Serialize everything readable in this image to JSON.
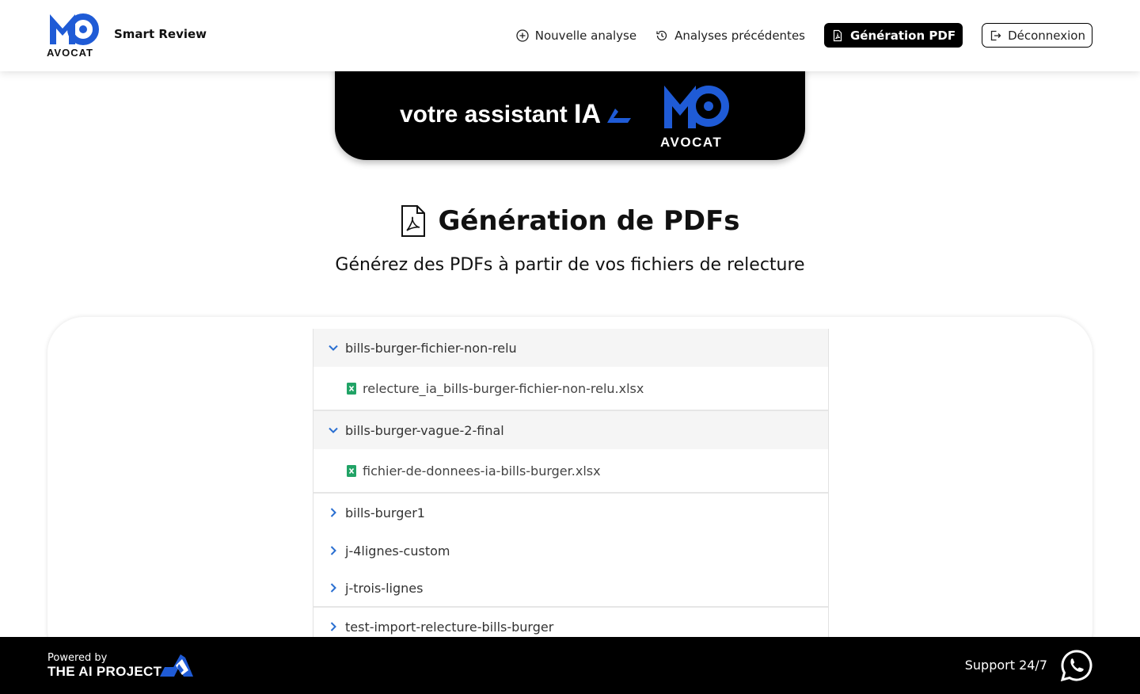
{
  "header": {
    "logo_text": "AVOCAT",
    "app_name": "Smart Review",
    "nav": {
      "new_analysis": "Nouvelle analyse",
      "previous_analyses": "Analyses précédentes",
      "pdf_generation": "Génération PDF",
      "logout": "Déconnexion"
    }
  },
  "banner": {
    "tagline": "votre assistant",
    "brand": "AVOCAT"
  },
  "page": {
    "title": "Génération de PDFs",
    "subtitle": "Générez des PDFs à partir de vos fichiers de relecture"
  },
  "tree": {
    "folders": [
      {
        "name": "bills-burger-fichier-non-relu",
        "expanded": true,
        "files": [
          "relecture_ia_bills-burger-fichier-non-relu.xlsx"
        ]
      },
      {
        "name": "bills-burger-vague-2-final",
        "expanded": true,
        "files": [
          "fichier-de-donnees-ia-bills-burger.xlsx"
        ]
      },
      {
        "name": "bills-burger1",
        "expanded": false,
        "files": []
      },
      {
        "name": "j-4lignes-custom",
        "expanded": false,
        "files": []
      },
      {
        "name": "j-trois-lignes",
        "expanded": false,
        "files": []
      },
      {
        "name": "test-import-relecture-bills-burger",
        "expanded": false,
        "files": []
      }
    ]
  },
  "footer": {
    "powered_by": "Powered by",
    "company": "THE AI PROJECT",
    "support": "Support 24/7"
  },
  "colors": {
    "brand_blue": "#1f5bd6",
    "excel_green": "#21a366",
    "chevron_blue": "#2a6fd1"
  },
  "icons": {
    "new_analysis": "plus-circle-icon",
    "previous_analyses": "history-icon",
    "pdf_generation": "pdf-file-icon",
    "logout": "logout-icon",
    "whatsapp": "whatsapp-icon"
  }
}
